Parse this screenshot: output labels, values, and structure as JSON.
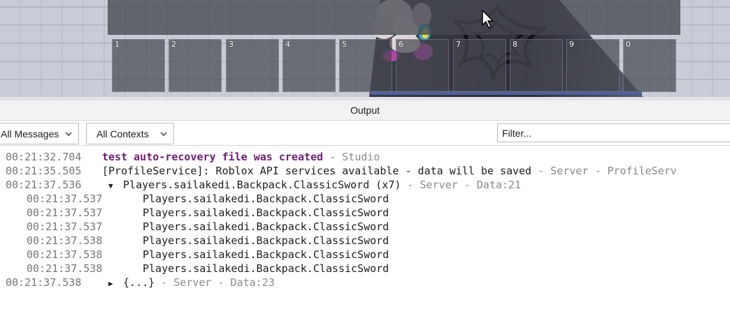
{
  "hotbar": {
    "slots": [
      "1",
      "2",
      "3",
      "4",
      "5",
      "6",
      "7",
      "8",
      "9",
      "0"
    ]
  },
  "output": {
    "title": "Output",
    "messages_filter": "All Messages",
    "contexts_filter": "All Contexts",
    "filter_placeholder": "Filter...",
    "rows": [
      {
        "timestamp": "00:21:32.704",
        "text": "test auto-recovery file was created",
        "meta": " -  Studio"
      },
      {
        "timestamp": "00:21:35.505",
        "text": "[ProfileService]: Roblox API services available - data will be saved",
        "meta": " -  Server - ProfileServ"
      },
      {
        "timestamp": "00:21:37.536",
        "toggle": "▼",
        "text": "Players.sailakedi.Backpack.ClassicSword (x7)",
        "meta": " -  Server - Data:21"
      },
      {
        "timestamp": "00:21:37.537",
        "text": "Players.sailakedi.Backpack.ClassicSword"
      },
      {
        "timestamp": "00:21:37.537",
        "text": "Players.sailakedi.Backpack.ClassicSword"
      },
      {
        "timestamp": "00:21:37.537",
        "text": "Players.sailakedi.Backpack.ClassicSword"
      },
      {
        "timestamp": "00:21:37.538",
        "text": "Players.sailakedi.Backpack.ClassicSword"
      },
      {
        "timestamp": "00:21:37.538",
        "text": "Players.sailakedi.Backpack.ClassicSword"
      },
      {
        "timestamp": "00:21:37.538",
        "text": "Players.sailakedi.Backpack.ClassicSword"
      },
      {
        "timestamp": "00:21:37.538",
        "toggle": "▶",
        "text": "{...}",
        "meta": " -  Server - Data:23"
      }
    ]
  },
  "colors": {
    "studio_message": "#6d1e74",
    "timestamp": "#777777",
    "hotbar_slot": "#464850"
  }
}
